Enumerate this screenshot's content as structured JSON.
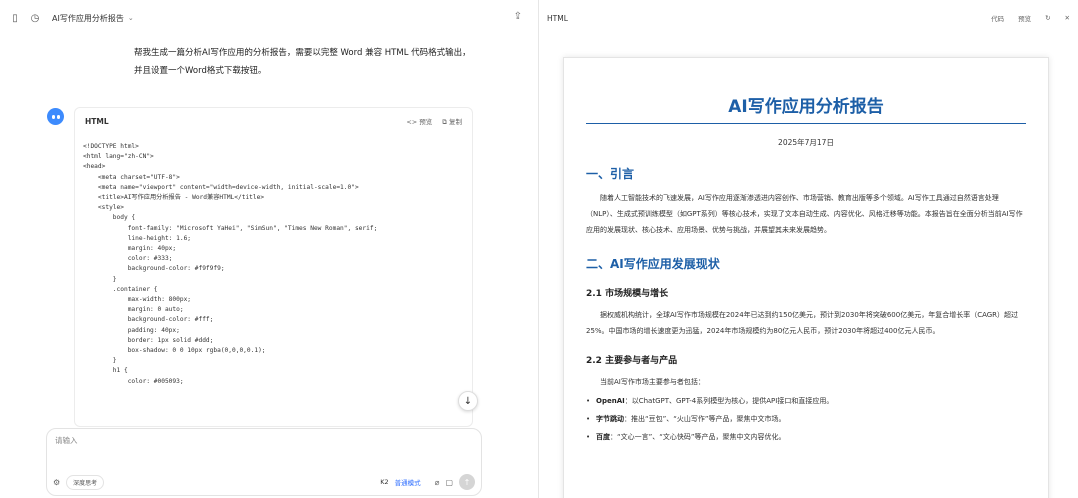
{
  "left": {
    "conversation_title": "AI写作应用分析报告",
    "user_message": "帮我生成一篇分析AI写作应用的分析报告，需要以完整 Word 兼容 HTML 代码格式输出，并且设置一个Word格式下载按钮。",
    "code_card": {
      "lang_label": "HTML",
      "action_preview": "<> 预览",
      "action_copy": "⧉ 复制",
      "lines": [
        "<!DOCTYPE html>",
        "<html lang=\"zh-CN\">",
        "<head>",
        "    <meta charset=\"UTF-8\">",
        "    <meta name=\"viewport\" content=\"width=device-width, initial-scale=1.0\">",
        "    <title>AI写作应用分析报告 - Word兼容HTML</title>",
        "    <style>",
        "        body {",
        "            font-family: \"Microsoft YaHei\", \"SimSun\", \"Times New Roman\", serif;",
        "            line-height: 1.6;",
        "            margin: 40px;",
        "            color: #333;",
        "            background-color: #f9f9f9;",
        "        }",
        "        .container {",
        "            max-width: 800px;",
        "            margin: 0 auto;",
        "            background-color: #fff;",
        "            padding: 40px;",
        "            border: 1px solid #ddd;",
        "            box-shadow: 0 0 10px rgba(0,0,0,0.1);",
        "        }",
        "        h1 {",
        "            color: #005093;"
      ]
    },
    "composer": {
      "placeholder": "请输入",
      "deep_think": "深度思考",
      "model": "K2",
      "mode": "普通模式"
    }
  },
  "right": {
    "header_label": "HTML",
    "action_code": "代码",
    "action_preview": "预览",
    "doc": {
      "title": "AI写作应用分析报告",
      "date": "2025年7月17日",
      "h_intro": "一、引言",
      "intro": "随着人工智能技术的飞速发展，AI写作应用逐渐渗透进内容创作、市场营销、教育出版等多个领域。AI写作工具通过自然语言处理（NLP）、生成式预训练模型（如GPT系列）等核心技术，实现了文本自动生成、内容优化、风格迁移等功能。本报告旨在全面分析当前AI写作应用的发展现状、核心技术、应用场景、优势与挑战，并展望其未来发展趋势。",
      "h_status": "二、AI写作应用发展现状",
      "h_market": "2.1 市场规模与增长",
      "market": "据权威机构统计，全球AI写作市场规模在2024年已达到约150亿美元，预计到2030年将突破600亿美元，年复合增长率（CAGR）超过25%。中国市场的增长速度更为迅猛，2024年市场规模约为80亿元人民币，预计2030年将超过400亿元人民币。",
      "h_players": "2.2 主要参与者与产品",
      "players_intro": "当前AI写作市场主要参与者包括：",
      "bullets": [
        {
          "name": "OpenAI",
          "text": "：以ChatGPT、GPT-4系列模型为核心，提供API接口和直接应用。"
        },
        {
          "name": "字节跳动",
          "text": "：推出“豆包”、“火山写作”等产品，聚焦中文市场。"
        },
        {
          "name": "百度",
          "text": "：“文心一言”、“文心快码”等产品，聚焦中文内容优化。"
        }
      ]
    }
  }
}
